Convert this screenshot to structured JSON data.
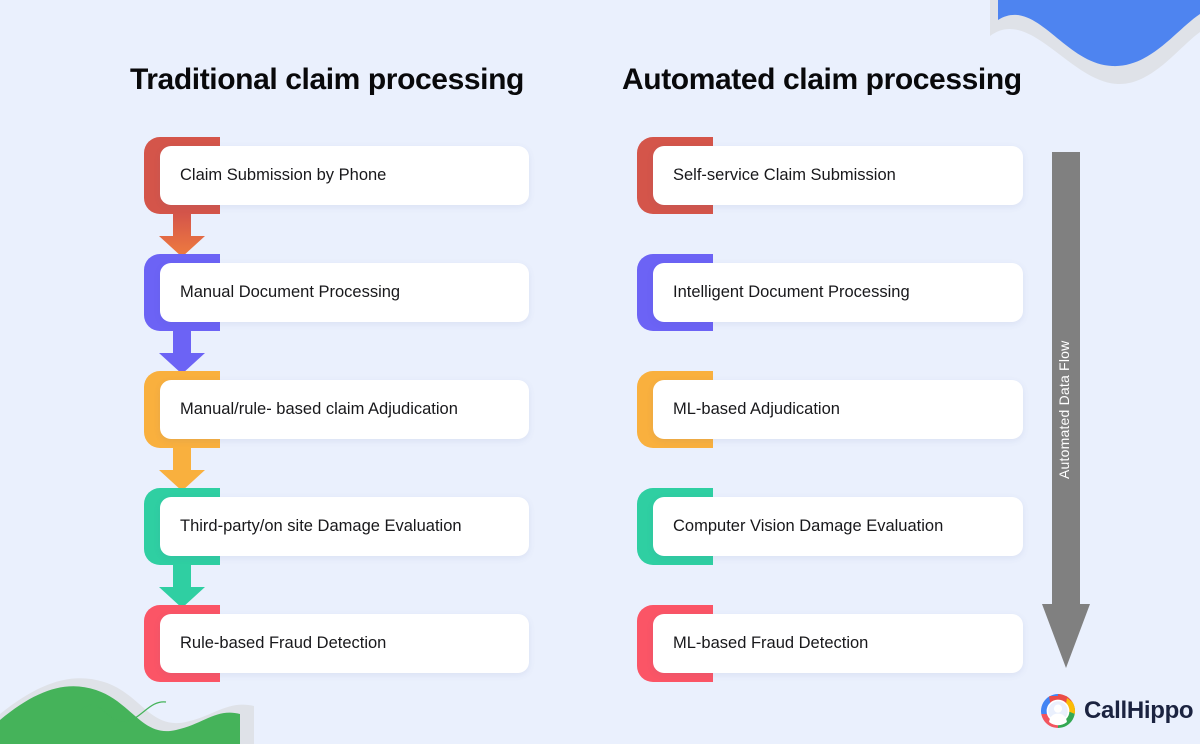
{
  "page": {
    "background_color": "#eaf0fd"
  },
  "columns": [
    {
      "id": "traditional",
      "title": "Traditional claim processing",
      "has_arrows": true,
      "steps": [
        {
          "label": "Claim Submission by Phone",
          "color": "#d4554a",
          "arrow_from": "#d4554a",
          "arrow_to": "#ef7c3f"
        },
        {
          "label": "Manual Document Processing",
          "color": "#6c63f5",
          "arrow_from": "#6c63f5",
          "arrow_to": "#6c63f5"
        },
        {
          "label": "Manual/rule- based claim Adjudication",
          "color": "#f9b03e",
          "arrow_from": "#f9b03e",
          "arrow_to": "#f9b03e"
        },
        {
          "label": "Third-party/on site Damage Evaluation",
          "color": "#2fcfa2",
          "arrow_from": "#2fcfa2",
          "arrow_to": "#2fcfa2"
        },
        {
          "label": "Rule-based Fraud Detection",
          "color": "#fb5566",
          "arrow_from": "#fb5566",
          "arrow_to": "#fb5566"
        }
      ]
    },
    {
      "id": "automated",
      "title": "Automated claim processing",
      "has_arrows": false,
      "steps": [
        {
          "label": "Self-service Claim Submission",
          "color": "#d4554a"
        },
        {
          "label": "Intelligent Document Processing",
          "color": "#6c63f5"
        },
        {
          "label": "ML-based Adjudication",
          "color": "#f9b03e"
        },
        {
          "label": "Computer Vision Damage Evaluation",
          "color": "#2fcfa2"
        },
        {
          "label": "ML-based Fraud Detection",
          "color": "#fb5566"
        }
      ]
    }
  ],
  "data_flow": {
    "label": "Automated Data Flow",
    "color": "#808080"
  },
  "brand": {
    "name": "CallHippo",
    "logo_colors": {
      "blue": "#4285f4",
      "red": "#ea4c48",
      "yellow": "#fbbc05",
      "green": "#34a853",
      "pink": "#f2555f"
    }
  },
  "decorations": {
    "top_right_blob_color": "#4e84f0",
    "bottom_left_blob_color": "#45b35a",
    "blob_shadow_color": "#dfe2e8"
  }
}
